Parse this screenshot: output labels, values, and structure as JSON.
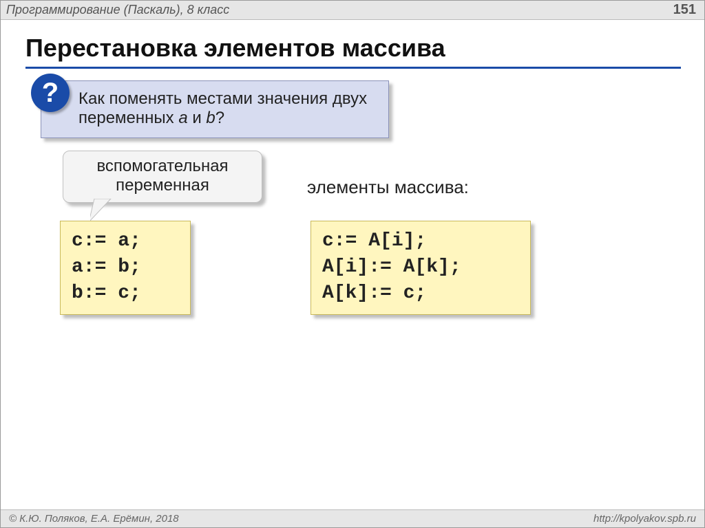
{
  "header": {
    "course": "Программирование (Паскаль), 8 класс",
    "page": "151"
  },
  "title": "Перестановка элементов массива",
  "question": {
    "icon": "?",
    "line1": "Как поменять местами значения двух",
    "line2_prefix": "переменных ",
    "var_a": "a",
    "and": " и ",
    "var_b": "b",
    "qmark": "?"
  },
  "bubble": {
    "line1": "вспомогательная",
    "line2": "переменная"
  },
  "array_label": "элементы массива:",
  "code_left": "c:= a;\na:= b;\nb:= c;",
  "code_right": "c:= A[i];\nA[i]:= A[k];\nA[k]:= c;",
  "footer": {
    "authors": "К.Ю. Поляков, Е.А. Ерёмин, 2018",
    "url": "http://kpolyakov.spb.ru"
  }
}
